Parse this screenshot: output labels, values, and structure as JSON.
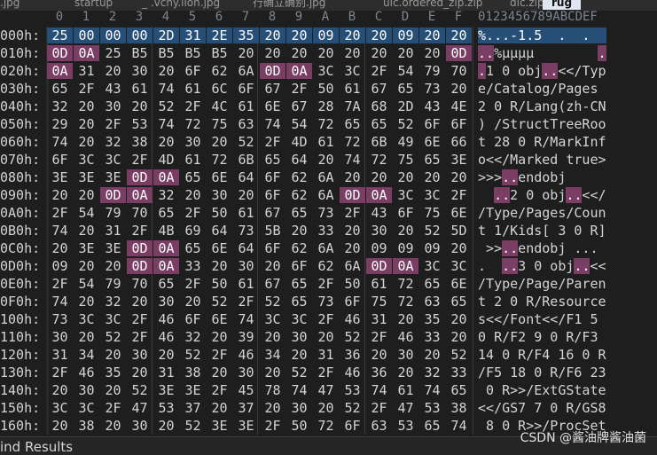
{
  "tabs": [
    {
      "label": ".jpg",
      "active": false
    },
    {
      "label": "startup",
      "active": false
    },
    {
      "label": "_ .vchy.ilon.jpg",
      "active": false
    },
    {
      "label": "行确立确别.jpg",
      "active": false
    },
    {
      "label": "uic.ordered_zip.zip",
      "active": false
    },
    {
      "label": "dic.zip",
      "active": false
    },
    {
      "label": "rug",
      "active": true
    }
  ],
  "column_headers": [
    "0",
    "1",
    "2",
    "3",
    "4",
    "5",
    "6",
    "7",
    "8",
    "9",
    "A",
    "B",
    "C",
    "D",
    "E",
    "F"
  ],
  "ascii_header": "0123456789ABCDEF",
  "rows": [
    {
      "addr": "000h:",
      "bytes": [
        "25",
        "00",
        "00",
        "00",
        "2D",
        "31",
        "2E",
        "35",
        "20",
        "20",
        "09",
        "20",
        "20",
        "09",
        "20",
        "20"
      ],
      "ascii": "%...-1.5  .  .  "
    },
    {
      "addr": "010h:",
      "bytes": [
        "0D",
        "0A",
        "25",
        "B5",
        "B5",
        "B5",
        "B5",
        "20",
        "20",
        "20",
        "20",
        "20",
        "20",
        "20",
        "20",
        "0D"
      ],
      "ascii": "..%µµµµ        ."
    },
    {
      "addr": "020h:",
      "bytes": [
        "0A",
        "31",
        "20",
        "30",
        "20",
        "6F",
        "62",
        "6A",
        "0D",
        "0A",
        "3C",
        "3C",
        "2F",
        "54",
        "79",
        "70"
      ],
      "ascii": ".1 0 obj..<</Typ"
    },
    {
      "addr": "030h:",
      "bytes": [
        "65",
        "2F",
        "43",
        "61",
        "74",
        "61",
        "6C",
        "6F",
        "67",
        "2F",
        "50",
        "61",
        "67",
        "65",
        "73",
        "20"
      ],
      "ascii": "e/Catalog/Pages "
    },
    {
      "addr": "040h:",
      "bytes": [
        "32",
        "20",
        "30",
        "20",
        "52",
        "2F",
        "4C",
        "61",
        "6E",
        "67",
        "28",
        "7A",
        "68",
        "2D",
        "43",
        "4E"
      ],
      "ascii": "2 0 R/Lang(zh-CN"
    },
    {
      "addr": "050h:",
      "bytes": [
        "29",
        "20",
        "2F",
        "53",
        "74",
        "72",
        "75",
        "63",
        "74",
        "54",
        "72",
        "65",
        "65",
        "52",
        "6F",
        "6F"
      ],
      "ascii": ") /StructTreeRoo"
    },
    {
      "addr": "060h:",
      "bytes": [
        "74",
        "20",
        "32",
        "38",
        "20",
        "30",
        "20",
        "52",
        "2F",
        "4D",
        "61",
        "72",
        "6B",
        "49",
        "6E",
        "66"
      ],
      "ascii": "t 28 0 R/MarkInf"
    },
    {
      "addr": "070h:",
      "bytes": [
        "6F",
        "3C",
        "3C",
        "2F",
        "4D",
        "61",
        "72",
        "6B",
        "65",
        "64",
        "20",
        "74",
        "72",
        "75",
        "65",
        "3E"
      ],
      "ascii": "o<</Marked true>"
    },
    {
      "addr": "080h:",
      "bytes": [
        "3E",
        "3E",
        "3E",
        "0D",
        "0A",
        "65",
        "6E",
        "64",
        "6F",
        "62",
        "6A",
        "20",
        "20",
        "20",
        "20",
        "20"
      ],
      "ascii": ">>>..endobj     "
    },
    {
      "addr": "090h:",
      "bytes": [
        "20",
        "20",
        "0D",
        "0A",
        "32",
        "20",
        "30",
        "20",
        "6F",
        "62",
        "6A",
        "0D",
        "0A",
        "3C",
        "3C",
        "2F"
      ],
      "ascii": "  ..2 0 obj..<</"
    },
    {
      "addr": "0A0h:",
      "bytes": [
        "2F",
        "54",
        "79",
        "70",
        "65",
        "2F",
        "50",
        "61",
        "67",
        "65",
        "73",
        "2F",
        "43",
        "6F",
        "75",
        "6E"
      ],
      "ascii": "/Type/Pages/Coun"
    },
    {
      "addr": "0B0h:",
      "bytes": [
        "74",
        "20",
        "31",
        "2F",
        "4B",
        "69",
        "64",
        "73",
        "5B",
        "20",
        "33",
        "20",
        "30",
        "20",
        "52",
        "5D"
      ],
      "ascii": "t 1/Kids[ 3 0 R]"
    },
    {
      "addr": "0C0h:",
      "bytes": [
        "20",
        "3E",
        "3E",
        "0D",
        "0A",
        "65",
        "6E",
        "64",
        "6F",
        "62",
        "6A",
        "20",
        "09",
        "09",
        "09",
        "20"
      ],
      "ascii": " >>..endobj ... "
    },
    {
      "addr": "0D0h:",
      "bytes": [
        "09",
        "20",
        "20",
        "0D",
        "0A",
        "33",
        "20",
        "30",
        "20",
        "6F",
        "62",
        "6A",
        "0D",
        "0A",
        "3C",
        "3C"
      ],
      "ascii": ".  ..3 0 obj..<<"
    },
    {
      "addr": "0E0h:",
      "bytes": [
        "2F",
        "54",
        "79",
        "70",
        "65",
        "2F",
        "50",
        "61",
        "67",
        "65",
        "2F",
        "50",
        "61",
        "72",
        "65",
        "6E"
      ],
      "ascii": "/Type/Page/Paren"
    },
    {
      "addr": "0F0h:",
      "bytes": [
        "74",
        "20",
        "32",
        "20",
        "30",
        "20",
        "52",
        "2F",
        "52",
        "65",
        "73",
        "6F",
        "75",
        "72",
        "63",
        "65"
      ],
      "ascii": "t 2 0 R/Resource"
    },
    {
      "addr": "100h:",
      "bytes": [
        "73",
        "3C",
        "3C",
        "2F",
        "46",
        "6F",
        "6E",
        "74",
        "3C",
        "3C",
        "2F",
        "46",
        "31",
        "20",
        "35",
        "20"
      ],
      "ascii": "s<</Font<</F1 5 "
    },
    {
      "addr": "110h:",
      "bytes": [
        "30",
        "20",
        "52",
        "2F",
        "46",
        "32",
        "20",
        "39",
        "20",
        "30",
        "20",
        "52",
        "2F",
        "46",
        "33",
        "20"
      ],
      "ascii": "0 R/F2 9 0 R/F3 "
    },
    {
      "addr": "120h:",
      "bytes": [
        "31",
        "34",
        "20",
        "30",
        "20",
        "52",
        "2F",
        "46",
        "34",
        "20",
        "31",
        "36",
        "20",
        "30",
        "20",
        "52"
      ],
      "ascii": "14 0 R/F4 16 0 R"
    },
    {
      "addr": "130h:",
      "bytes": [
        "2F",
        "46",
        "35",
        "20",
        "31",
        "38",
        "20",
        "30",
        "20",
        "52",
        "2F",
        "46",
        "36",
        "20",
        "32",
        "33"
      ],
      "ascii": "/F5 18 0 R/F6 23"
    },
    {
      "addr": "140h:",
      "bytes": [
        "20",
        "30",
        "20",
        "52",
        "3E",
        "3E",
        "2F",
        "45",
        "78",
        "74",
        "47",
        "53",
        "74",
        "61",
        "74",
        "65"
      ],
      "ascii": " 0 R>>/ExtGState"
    },
    {
      "addr": "150h:",
      "bytes": [
        "3C",
        "3C",
        "2F",
        "47",
        "53",
        "37",
        "20",
        "37",
        "20",
        "30",
        "20",
        "52",
        "2F",
        "47",
        "53",
        "38"
      ],
      "ascii": "<</GS7 7 0 R/GS8"
    },
    {
      "addr": "160h:",
      "bytes": [
        "20",
        "38",
        "20",
        "30",
        "20",
        "52",
        "3E",
        "3E",
        "2F",
        "50",
        "72",
        "6F",
        "63",
        "53",
        "65",
        "74"
      ],
      "ascii": " 8 0 R>>/ProcSet"
    }
  ],
  "status": {
    "find_results": "ind Results"
  },
  "watermark": "CSDN @酱油牌酱油菌",
  "colors": {
    "background": "#1e1e1e",
    "selection": "#264f78",
    "newline_highlight": "#7a3d63",
    "active_tab": "#dfe6ef"
  }
}
